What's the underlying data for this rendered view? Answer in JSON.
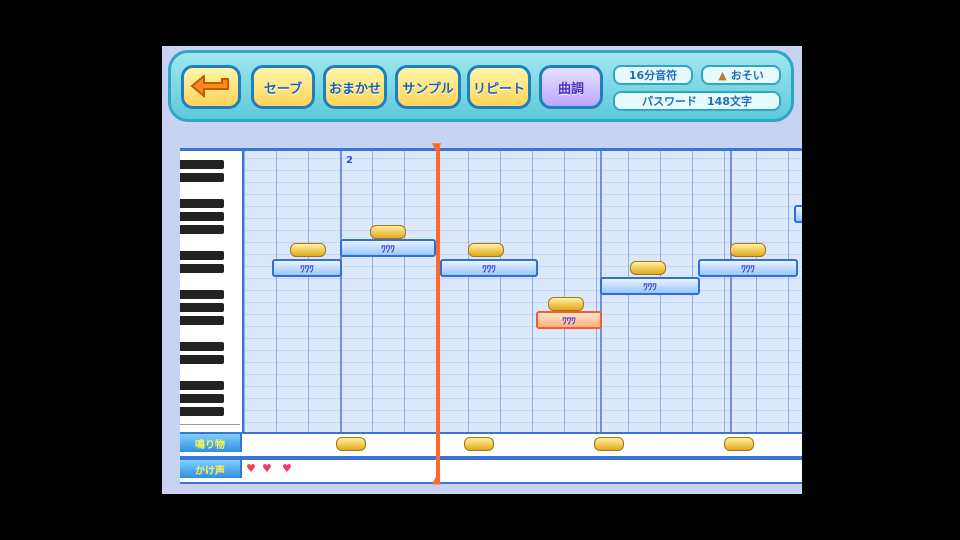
{
  "toolbar": {
    "back_icon": "back-arrow-icon",
    "save": "セーブ",
    "omakase": "おまかせ",
    "sample": "サンプル",
    "repeat": "リピート",
    "key": "曲調",
    "note_length": "16分音符",
    "tempo": "おそい",
    "tempo_icon": "metronome-icon",
    "password_label": "パスワード",
    "password_count": "148文字"
  },
  "track": {
    "measure_marker": "2"
  },
  "notes": [
    {
      "label": "ﾜﾜﾜ"
    },
    {
      "label": "ﾜﾜﾜ"
    },
    {
      "label": "ﾜﾜﾜ"
    },
    {
      "label": "ﾜﾜﾜ"
    },
    {
      "label": "ﾜﾜﾜ"
    },
    {
      "label": "ﾜﾜﾜ"
    }
  ],
  "rows": {
    "row1": "鳴り物",
    "row2": "かけ声"
  },
  "colors": {
    "accent": "#ff6a2a",
    "note_border": "#2f6fd6"
  }
}
